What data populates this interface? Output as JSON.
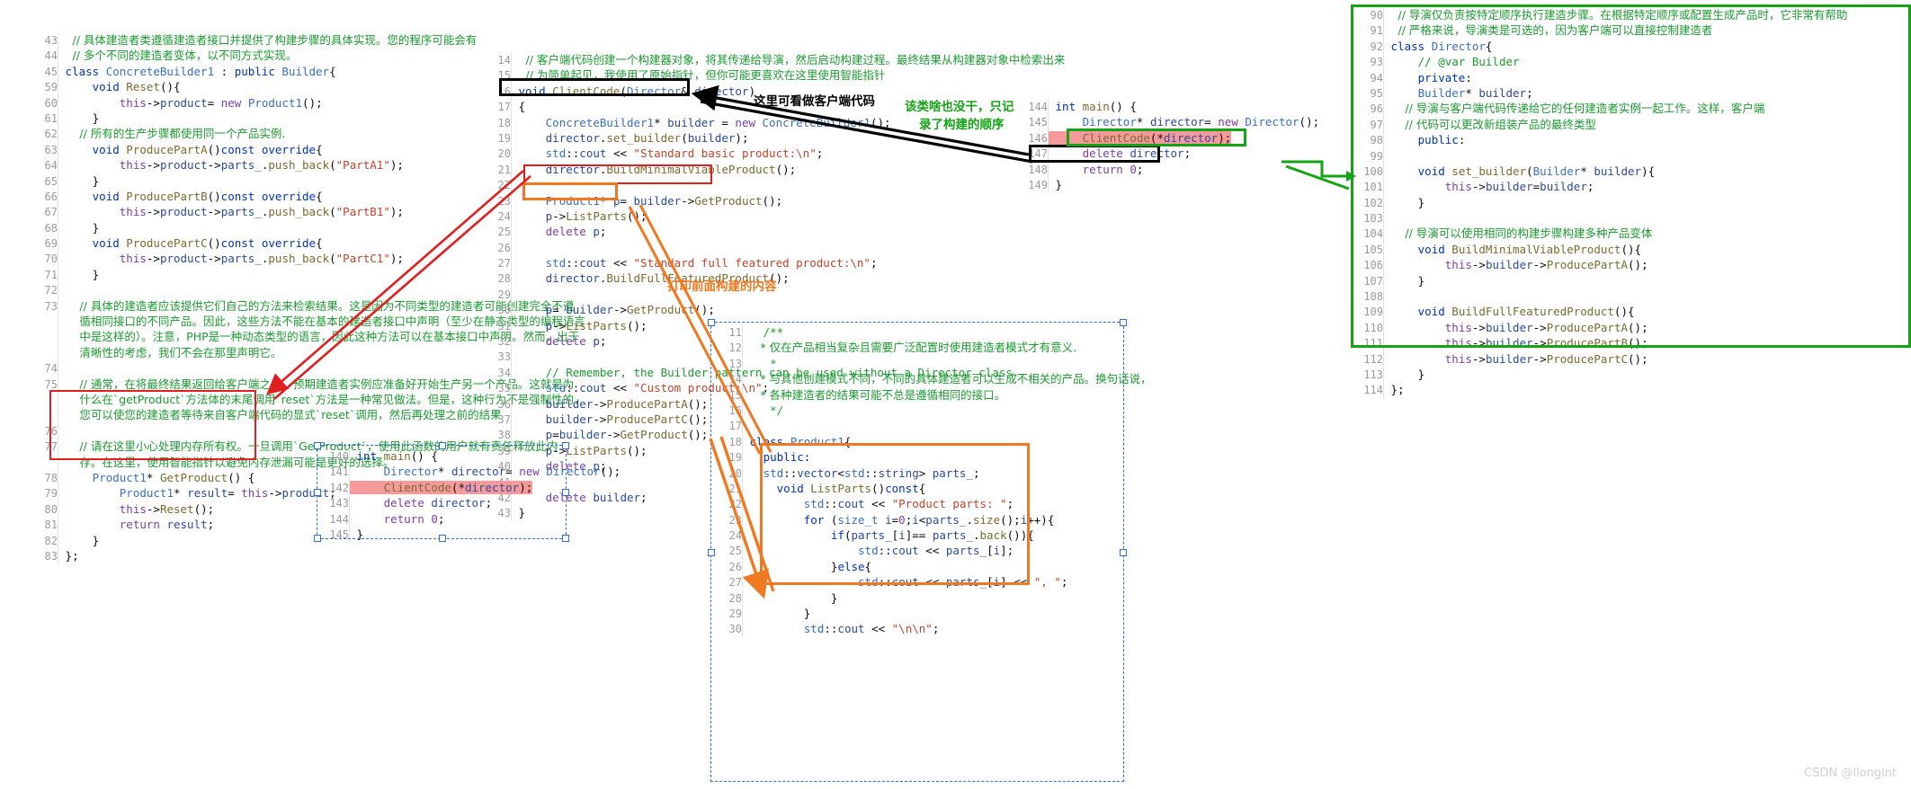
{
  "watermark": "CSDN @llongint",
  "panels": {
    "left": {
      "name": "concrete-builder-panel",
      "lines": [
        {
          "n": "43",
          "t": "  // 具体建造者类遵循建造者接口并提供了构建步骤的具体实现。您的程序可能会有"
        },
        {
          "n": "44",
          "t": "  // 多个不同的建造者变体，以不同方式实现。"
        },
        {
          "n": "45",
          "t": "class ConcreteBuilder1 : public Builder{"
        },
        {
          "n": "59",
          "t": "    void Reset(){"
        },
        {
          "n": "60",
          "t": "        this->product= new Product1();"
        },
        {
          "n": "61",
          "t": "    }"
        },
        {
          "n": "62",
          "t": "    // 所有的生产步骤都使用同一个产品实例."
        },
        {
          "n": "63",
          "t": "    void ProducePartA()const override{"
        },
        {
          "n": "64",
          "t": "        this->product->parts_.push_back(\"PartA1\");"
        },
        {
          "n": "65",
          "t": "    }"
        },
        {
          "n": "66",
          "t": "    void ProducePartB()const override{"
        },
        {
          "n": "67",
          "t": "        this->product->parts_.push_back(\"PartB1\");"
        },
        {
          "n": "68",
          "t": "    }"
        },
        {
          "n": "69",
          "t": "    void ProducePartC()const override{"
        },
        {
          "n": "70",
          "t": "        this->product->parts_.push_back(\"PartC1\");"
        },
        {
          "n": "71",
          "t": "    }"
        },
        {
          "n": "72",
          "t": ""
        },
        {
          "n": "73",
          "t": "    // 具体的建造者应该提供它们自己的方法来检索结果。这是因为不同类型的建造者可能创建完全不遵"
        },
        {
          "n": "",
          "t": "    循相同接口的不同产品。因此，这些方法不能在基本的建造者接口中声明（至少在静态类型的编程语言"
        },
        {
          "n": "",
          "t": "    中是这样的）。注意，PHP是一种动态类型的语言，因此这种方法可以在基本接口中声明。然而，出于"
        },
        {
          "n": "",
          "t": "    清晰性的考虑，我们不会在那里声明它。"
        },
        {
          "n": "74",
          "t": ""
        },
        {
          "n": "75",
          "t": "    // 通常，在将最终结果返回给客户端之后，预期建造者实例应准备好开始生产另一个产品。这就是为"
        },
        {
          "n": "",
          "t": "    什么在`getProduct`方法体的末尾调用`reset`方法是一种常见做法。但是，这种行为不是强制性的，"
        },
        {
          "n": "",
          "t": "    您可以使您的建造者等待来自客户端代码的显式`reset`调用，然后再处理之前的结果"
        },
        {
          "n": "76",
          "t": ""
        },
        {
          "n": "77",
          "t": "    // 请在这里小心处理内存所有权。一旦调用`GetProduct`，使用此函数的用户就有责任释放此内"
        },
        {
          "n": "",
          "t": "    存。在这里，使用智能指针以避免内存泄漏可能是更好的选择。"
        },
        {
          "n": "78",
          "t": "    Product1* GetProduct() {"
        },
        {
          "n": "79",
          "t": "        Product1* result= this->product;"
        },
        {
          "n": "80",
          "t": "        this->Reset();"
        },
        {
          "n": "81",
          "t": "        return result;"
        },
        {
          "n": "82",
          "t": "    }"
        },
        {
          "n": "83",
          "t": "};"
        }
      ]
    },
    "middle": {
      "name": "client-code-panel",
      "lines": [
        {
          "n": "14",
          "t": "  // 客户端代码创建一个构建器对象，将其传递给导演，然后启动构建过程。最终结果从构建器对象中检索出来"
        },
        {
          "n": "15",
          "t": "  // 为简单起见，我使用了原始指针，但你可能更喜欢在这里使用智能指针"
        },
        {
          "n": "16",
          "t": "void ClientCode(Director& director)"
        },
        {
          "n": "17",
          "t": "{"
        },
        {
          "n": "18",
          "t": "    ConcreteBuilder1* builder = new ConcreteBuilder1();"
        },
        {
          "n": "19",
          "t": "    director.set_builder(builder);"
        },
        {
          "n": "20",
          "t": "    std::cout << \"Standard basic product:\\n\";"
        },
        {
          "n": "21",
          "t": "    director.BuildMinimalViableProduct();"
        },
        {
          "n": "22",
          "t": ""
        },
        {
          "n": "23",
          "t": "    Product1* p= builder->GetProduct();"
        },
        {
          "n": "24",
          "t": "    p->ListParts();"
        },
        {
          "n": "25",
          "t": "    delete p;"
        },
        {
          "n": "26",
          "t": ""
        },
        {
          "n": "27",
          "t": "    std::cout << \"Standard full featured product:\\n\";"
        },
        {
          "n": "28",
          "t": "    director.BuildFullFeaturedProduct();"
        },
        {
          "n": "29",
          "t": ""
        },
        {
          "n": "30",
          "t": "    p= builder->GetProduct();"
        },
        {
          "n": "31",
          "t": "    p->ListParts();"
        },
        {
          "n": "32",
          "t": "    delete p;"
        },
        {
          "n": "33",
          "t": ""
        },
        {
          "n": "34",
          "t": "    // Remember, the Builder pattern can be used without a Director class."
        },
        {
          "n": "35",
          "t": "    std::cout << \"Custom product:\\n\";"
        },
        {
          "n": "36",
          "t": "    builder->ProducePartA();"
        },
        {
          "n": "37",
          "t": "    builder->ProducePartC();"
        },
        {
          "n": "38",
          "t": "    p=builder->GetProduct();"
        },
        {
          "n": "39",
          "t": "    p->ListParts();"
        },
        {
          "n": "40",
          "t": "    delete p;"
        },
        {
          "n": "41",
          "t": ""
        },
        {
          "n": "42",
          "t": "    delete builder;"
        },
        {
          "n": "43",
          "t": "}"
        }
      ]
    },
    "main_bottom": {
      "name": "main-function-panel-bottom",
      "lines": [
        {
          "n": "140",
          "t": "int main() {"
        },
        {
          "n": "141",
          "t": "    Director* director= new Director();"
        },
        {
          "n": "142",
          "t": "    ClientCode(*director);"
        },
        {
          "n": "143",
          "t": "    delete director;"
        },
        {
          "n": "144",
          "t": "    return 0;"
        },
        {
          "n": "145",
          "t": "}"
        }
      ]
    },
    "main_right": {
      "name": "main-function-panel-right",
      "lines": [
        {
          "n": "144",
          "t": "int main() {"
        },
        {
          "n": "145",
          "t": "    Director* director= new Director();"
        },
        {
          "n": "146",
          "t": "    ClientCode(*director);"
        },
        {
          "n": "147",
          "t": "    delete director;"
        },
        {
          "n": "148",
          "t": "    return 0;"
        },
        {
          "n": "149",
          "t": "}"
        }
      ]
    },
    "product": {
      "name": "product1-panel",
      "lines": [
        {
          "n": "11",
          "t": "  /**"
        },
        {
          "n": "12",
          "t": "   * 仅在产品相当复杂且需要广泛配置时使用建造者模式才有意义."
        },
        {
          "n": "13",
          "t": "   *"
        },
        {
          "n": "14",
          "t": "   * 与其他创建模式不同，不同的具体建造者可以生成不相关的产品。换句话说，"
        },
        {
          "n": "15",
          "t": "   * 各种建造者的结果可能不总是遵循相同的接口。"
        },
        {
          "n": "16",
          "t": "   */"
        },
        {
          "n": "17",
          "t": ""
        },
        {
          "n": "18",
          "t": "class Product1{"
        },
        {
          "n": "19",
          "t": "  public:"
        },
        {
          "n": "20",
          "t": "  std::vector<std::string> parts_;"
        },
        {
          "n": "21",
          "t": "    void ListParts()const{"
        },
        {
          "n": "22",
          "t": "        std::cout << \"Product parts: \";"
        },
        {
          "n": "23",
          "t": "        for (size_t i=0;i<parts_.size();i++){"
        },
        {
          "n": "24",
          "t": "            if(parts_[i]== parts_.back()){"
        },
        {
          "n": "25",
          "t": "                std::cout << parts_[i];"
        },
        {
          "n": "26",
          "t": "            }else{"
        },
        {
          "n": "27",
          "t": "                std::cout << parts_[i] << \", \";"
        },
        {
          "n": "28",
          "t": "            }"
        },
        {
          "n": "29",
          "t": "        }"
        },
        {
          "n": "30",
          "t": "        std::cout << \"\\n\\n\";"
        }
      ]
    },
    "director": {
      "name": "director-panel",
      "lines": [
        {
          "n": "90",
          "t": "  // 导演仅负责按特定顺序执行建造步骤。在根据特定顺序或配置生成产品时，它非常有帮助"
        },
        {
          "n": "91",
          "t": "  // 严格来说，导演类是可选的，因为客户端可以直接控制建造者"
        },
        {
          "n": "92",
          "t": "class Director{"
        },
        {
          "n": "93",
          "t": "    // @var Builder"
        },
        {
          "n": "94",
          "t": "    private:"
        },
        {
          "n": "95",
          "t": "    Builder* builder;"
        },
        {
          "n": "96",
          "t": "    // 导演与客户端代码传递给它的任何建造者实例一起工作。这样，客户端"
        },
        {
          "n": "97",
          "t": "    // 代码可以更改新组装产品的最终类型"
        },
        {
          "n": "98",
          "t": "    public:"
        },
        {
          "n": "99",
          "t": ""
        },
        {
          "n": "100",
          "t": "    void set_builder(Builder* builder){"
        },
        {
          "n": "101",
          "t": "        this->builder=builder;"
        },
        {
          "n": "102",
          "t": "    }"
        },
        {
          "n": "103",
          "t": ""
        },
        {
          "n": "104",
          "t": "    // 导演可以使用相同的构建步骤构建多种产品变体"
        },
        {
          "n": "105",
          "t": "    void BuildMinimalViableProduct(){"
        },
        {
          "n": "106",
          "t": "        this->builder->ProducePartA();"
        },
        {
          "n": "107",
          "t": "    }"
        },
        {
          "n": "108",
          "t": ""
        },
        {
          "n": "109",
          "t": "    void BuildFullFeaturedProduct(){"
        },
        {
          "n": "110",
          "t": "        this->builder->ProducePartA();"
        },
        {
          "n": "111",
          "t": "        this->builder->ProducePartB();"
        },
        {
          "n": "112",
          "t": "        this->builder->ProducePartC();"
        },
        {
          "n": "113",
          "t": "    }"
        },
        {
          "n": "114",
          "t": "};"
        }
      ]
    }
  },
  "annotations": {
    "client_code_note": "这里可看做客户端代码",
    "director_note_line1": "该类啥也没干，只记",
    "director_note_line2": "录了构建的顺序",
    "print_note": "打印前面构建的内容"
  },
  "colors": {
    "red": "#e02020",
    "green": "#13a313",
    "orange": "#f07820",
    "black": "#000000",
    "blue_dashed": "#2d6fd8",
    "highlight_pink": "#f59a9a",
    "highlight_blue": "#dbe9fb"
  }
}
